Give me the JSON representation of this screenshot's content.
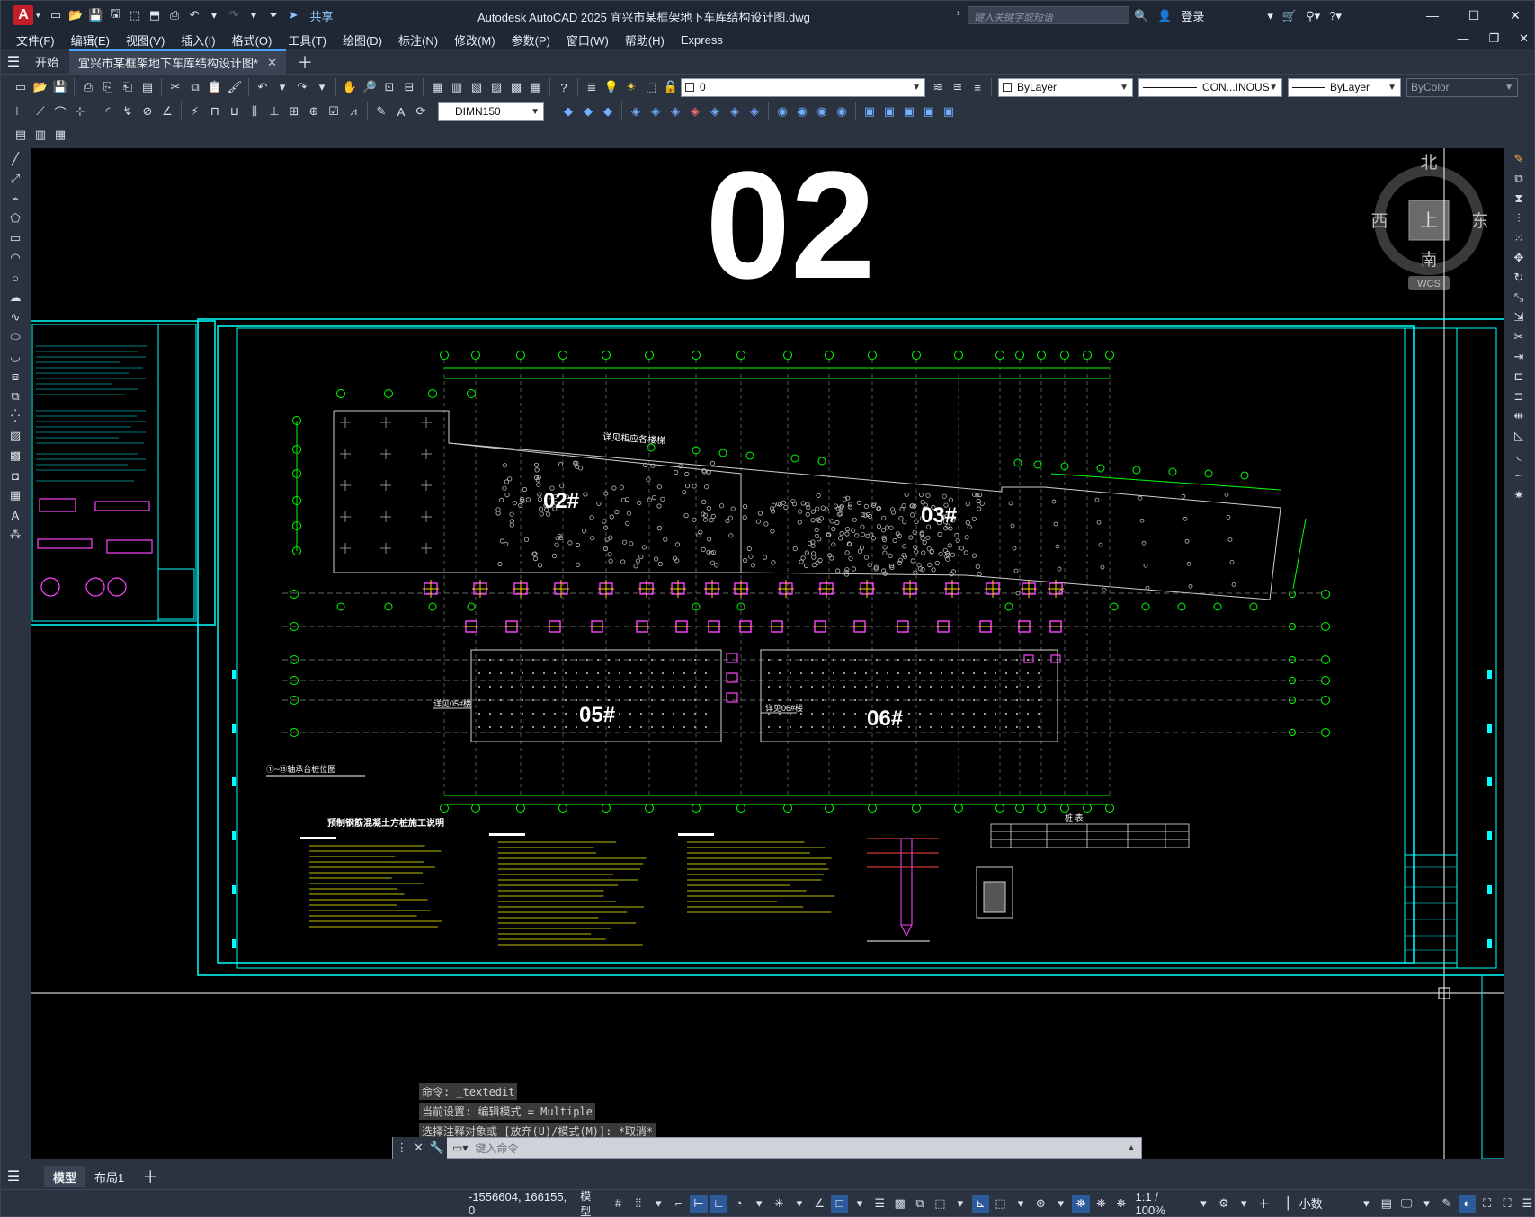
{
  "app": {
    "title": "Autodesk AutoCAD 2025    宜兴市某框架地下车库结构设计图.dwg",
    "logo": "A",
    "share": "共享",
    "search_placeholder": "键入关键字或短语",
    "login": "登录"
  },
  "menu": [
    "文件(F)",
    "编辑(E)",
    "视图(V)",
    "插入(I)",
    "格式(O)",
    "工具(T)",
    "绘图(D)",
    "标注(N)",
    "修改(M)",
    "参数(P)",
    "窗口(W)",
    "帮助(H)",
    "Express"
  ],
  "tabs": {
    "start": "开始",
    "drawing": "宜兴市某框架地下车库结构设计图*"
  },
  "properties": {
    "layer": "0",
    "color": "ByLayer",
    "linetype": "CON...INOUS",
    "lineweight": "ByLayer",
    "plotstyle": "ByColor",
    "dimstyle": "DIMN150"
  },
  "viewcube": {
    "north": "北",
    "south": "南",
    "east": "东",
    "west": "西",
    "top": "上",
    "wcs": "WCS"
  },
  "drawing": {
    "sheet_number": "02",
    "blocks": [
      "02#",
      "03#",
      "05#",
      "06#"
    ],
    "note_title_1": "预制钢筋混凝土方桩施工说明",
    "legend_title": "①~⑮轴承台桩位图",
    "table_title": "桩 表",
    "label_stair": "详见相应各楼梯",
    "label_05": "详见05#楼",
    "label_06": "详见06#楼"
  },
  "command": {
    "history": [
      "命令: _textedit",
      "当前设置: 编辑模式 = Multiple",
      "选择注释对象或 [放弃(U)/模式(M)]: *取消*"
    ],
    "placeholder": "键入命令"
  },
  "layouts": [
    "模型",
    "布局1"
  ],
  "status": {
    "coords": "-1556604, 166155, 0",
    "mode": "模型",
    "scale": "1:1 / 100%",
    "units": "小数"
  }
}
